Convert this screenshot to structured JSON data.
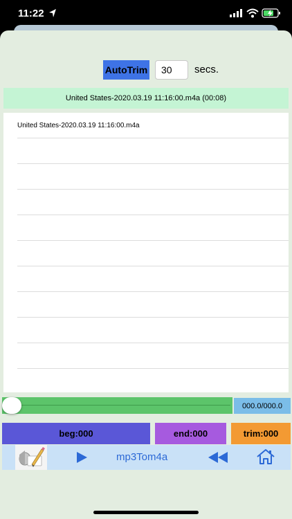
{
  "status_bar": {
    "time": "11:22"
  },
  "autotrim": {
    "button_label": "AutoTrim",
    "seconds_value": "30",
    "seconds_label": "secs."
  },
  "selected_file": "United States-2020.03.19 11:16:00.m4a (00:08)",
  "files": [
    "United States-2020.03.19 11:16:00.m4a",
    "",
    "",
    "",
    "",
    "",
    "",
    "",
    "",
    "",
    ""
  ],
  "player": {
    "position_fraction": 0,
    "time_display": "000.0/000.0"
  },
  "controls": {
    "beg_label": "beg:000",
    "end_label": "end:000",
    "trim_label": "trim:000"
  },
  "toolbar": {
    "title": "mp3Tom4a"
  },
  "colors": {
    "autotrim": "#3e73e6",
    "selected_file_bg": "#c4f4d4",
    "slider": "#5cc46a",
    "time_display": "#7bbde8",
    "beg": "#5a57d7",
    "end": "#a65adf",
    "trim": "#f39a33",
    "toolbar": "#c9e1f7",
    "toolbar_accent": "#2c69d6"
  }
}
